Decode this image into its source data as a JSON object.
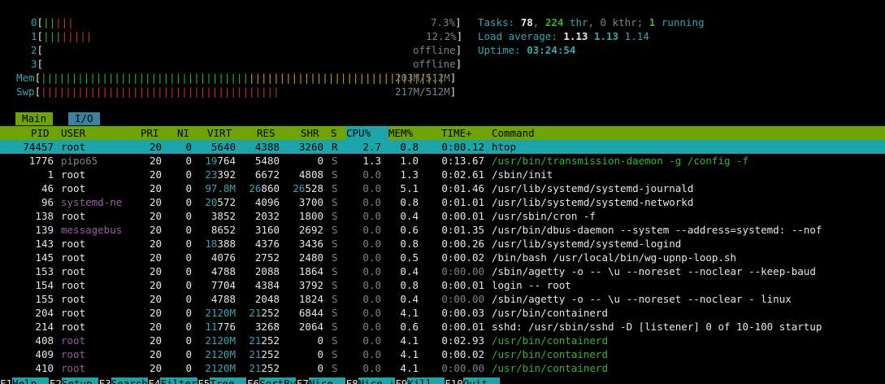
{
  "cpus": [
    {
      "id": "0",
      "bar": "|||||",
      "bar_color": "mixed",
      "value": "7.3%"
    },
    {
      "id": "1",
      "bar": "||||||||",
      "bar_color": "mixed",
      "value": "12.2%"
    },
    {
      "id": "2",
      "bar": "",
      "value": "offline"
    },
    {
      "id": "3",
      "bar": "",
      "value": "offline"
    }
  ],
  "mem": {
    "label": "Mem",
    "bar": "||||||||||||||||||||||||||||||||||||||||||||||||||||||||||||||||||||||||||||",
    "value": "203M/512M"
  },
  "swp": {
    "label": "Swp",
    "bar": "||||||||||||||||||||||||||||||||||||||||||||||||||||",
    "value": "217M/512M"
  },
  "summary": {
    "tasks_label": "Tasks: ",
    "tasks": "78",
    ", ": ", ",
    "thr": "224",
    " thr_label": " thr, ",
    "kthr": "0 kthr; ",
    "running": "1",
    " running_label": " running",
    "load_label": "Load average: ",
    "load1": "1.13",
    "load5": "1.13",
    "load15": "1.14",
    "uptime_label": "Uptime: ",
    "uptime": "03:24:54"
  },
  "tabs": [
    {
      "label": "Main"
    },
    {
      "label": "I/O"
    }
  ],
  "columns": [
    "PID",
    "USER",
    "PRI",
    "NI",
    "VIRT",
    "RES",
    "SHR",
    "S",
    "CPU%",
    "MEM%",
    "TIME+",
    "Command"
  ],
  "processes": [
    {
      "pid": "74457",
      "user": "root",
      "pri": "20",
      "ni": "0",
      "virt": "5640",
      "res": "4388",
      "shr": "3260",
      "s": "R",
      "cpu": "2.7",
      "mem": "0.8",
      "time": "0:00.12",
      "cmd": "htop",
      "selected": true
    },
    {
      "pid": "1776",
      "user": "pipo65",
      "pri": "20",
      "ni": "0",
      "virt": "19764",
      "res": "5480",
      "shr": "0",
      "s": "S",
      "cpu": "1.3",
      "mem": "1.0",
      "time": "0:13.67",
      "cmd": "/usr/bin/transmission-daemon -g /config -f",
      "thread": true
    },
    {
      "pid": "1",
      "user": "root",
      "pri": "20",
      "ni": "0",
      "virt": "23392",
      "res": "6672",
      "shr": "4808",
      "s": "S",
      "cpu": "0.0",
      "mem": "1.3",
      "time": "0:02.61",
      "cmd": "/sbin/init"
    },
    {
      "pid": "46",
      "user": "root",
      "pri": "20",
      "ni": "0",
      "virt": "97.8M",
      "res": "26860",
      "shr": "26528",
      "s": "S",
      "cpu": "0.0",
      "mem": "5.1",
      "time": "0:01.46",
      "cmd": "/usr/lib/systemd/systemd-journald"
    },
    {
      "pid": "96",
      "user": "systemd-ne",
      "pri": "20",
      "ni": "0",
      "virt": "20572",
      "res": "4096",
      "shr": "3700",
      "s": "S",
      "cpu": "0.0",
      "mem": "0.8",
      "time": "0:01.01",
      "cmd": "/usr/lib/systemd/systemd-networkd"
    },
    {
      "pid": "138",
      "user": "root",
      "pri": "20",
      "ni": "0",
      "virt": "3852",
      "res": "2032",
      "shr": "1800",
      "s": "S",
      "cpu": "0.0",
      "mem": "0.4",
      "time": "0:00.01",
      "cmd": "/usr/sbin/cron -f"
    },
    {
      "pid": "139",
      "user": "messagebus",
      "pri": "20",
      "ni": "0",
      "virt": "8652",
      "res": "3160",
      "shr": "2692",
      "s": "S",
      "cpu": "0.0",
      "mem": "0.6",
      "time": "0:01.35",
      "cmd": "/usr/bin/dbus-daemon --system --address=systemd: --nof"
    },
    {
      "pid": "143",
      "user": "root",
      "pri": "20",
      "ni": "0",
      "virt": "18388",
      "res": "4376",
      "shr": "3436",
      "s": "S",
      "cpu": "0.0",
      "mem": "0.8",
      "time": "0:00.26",
      "cmd": "/usr/lib/systemd/systemd-logind"
    },
    {
      "pid": "145",
      "user": "root",
      "pri": "20",
      "ni": "0",
      "virt": "4076",
      "res": "2752",
      "shr": "2480",
      "s": "S",
      "cpu": "0.0",
      "mem": "0.5",
      "time": "0:00.02",
      "cmd": "/bin/bash /usr/local/bin/wg-upnp-loop.sh"
    },
    {
      "pid": "153",
      "user": "root",
      "pri": "20",
      "ni": "0",
      "virt": "4788",
      "res": "2088",
      "shr": "1864",
      "s": "S",
      "cpu": "0.0",
      "mem": "0.4",
      "time": "0:00.00",
      "cmd": "/sbin/agetty -o -- \\u --noreset --noclear --keep-baud"
    },
    {
      "pid": "154",
      "user": "root",
      "pri": "20",
      "ni": "0",
      "virt": "7704",
      "res": "4384",
      "shr": "3792",
      "s": "S",
      "cpu": "0.0",
      "mem": "0.8",
      "time": "0:00.01",
      "cmd": "login -- root"
    },
    {
      "pid": "155",
      "user": "root",
      "pri": "20",
      "ni": "0",
      "virt": "4788",
      "res": "2048",
      "shr": "1824",
      "s": "S",
      "cpu": "0.0",
      "mem": "0.4",
      "time": "0:00.00",
      "cmd": "/sbin/agetty -o -- \\u --noreset --noclear - linux"
    },
    {
      "pid": "204",
      "user": "root",
      "pri": "20",
      "ni": "0",
      "virt": "2120M",
      "res": "21252",
      "shr": "6844",
      "s": "S",
      "cpu": "0.0",
      "mem": "4.1",
      "time": "0:00.03",
      "cmd": "/usr/bin/containerd"
    },
    {
      "pid": "214",
      "user": "root",
      "pri": "20",
      "ni": "0",
      "virt": "11776",
      "res": "3268",
      "shr": "2064",
      "s": "S",
      "cpu": "0.0",
      "mem": "0.6",
      "time": "0:00.01",
      "cmd": "sshd: /usr/sbin/sshd -D [listener] 0 of 10-100 startup"
    },
    {
      "pid": "408",
      "user": "root",
      "pri": "20",
      "ni": "0",
      "virt": "2120M",
      "res": "21252",
      "shr": "0",
      "s": "S",
      "cpu": "0.0",
      "mem": "4.1",
      "time": "0:02.93",
      "cmd": "/usr/bin/containerd",
      "thread": true
    },
    {
      "pid": "409",
      "user": "root",
      "pri": "20",
      "ni": "0",
      "virt": "2120M",
      "res": "21252",
      "shr": "0",
      "s": "S",
      "cpu": "0.0",
      "mem": "4.1",
      "time": "0:00.02",
      "cmd": "/usr/bin/containerd",
      "thread": true
    },
    {
      "pid": "410",
      "user": "root",
      "pri": "20",
      "ni": "0",
      "virt": "2120M",
      "res": "21252",
      "shr": "0",
      "s": "S",
      "cpu": "0.0",
      "mem": "4.1",
      "time": "0:00.00",
      "cmd": "/usr/bin/containerd",
      "thread": true
    }
  ],
  "fkeys": [
    {
      "key": "F1",
      "label": "Help  "
    },
    {
      "key": "F2",
      "label": "Setup "
    },
    {
      "key": "F3",
      "label": "Search"
    },
    {
      "key": "F4",
      "label": "Filter"
    },
    {
      "key": "F5",
      "label": "Tree  "
    },
    {
      "key": "F6",
      "label": "SortBy"
    },
    {
      "key": "F7",
      "label": "Nice -"
    },
    {
      "key": "F8",
      "label": "Nice +"
    },
    {
      "key": "F9",
      "label": "Kill  "
    },
    {
      "key": "F10",
      "label": "Quit  "
    }
  ],
  "colors": {
    "accent": "#1ca5a8",
    "header": "#6ea400",
    "cyan": "#2ea8b0",
    "green": "#32b432",
    "red": "#c83232",
    "yellow": "#c8a014"
  }
}
